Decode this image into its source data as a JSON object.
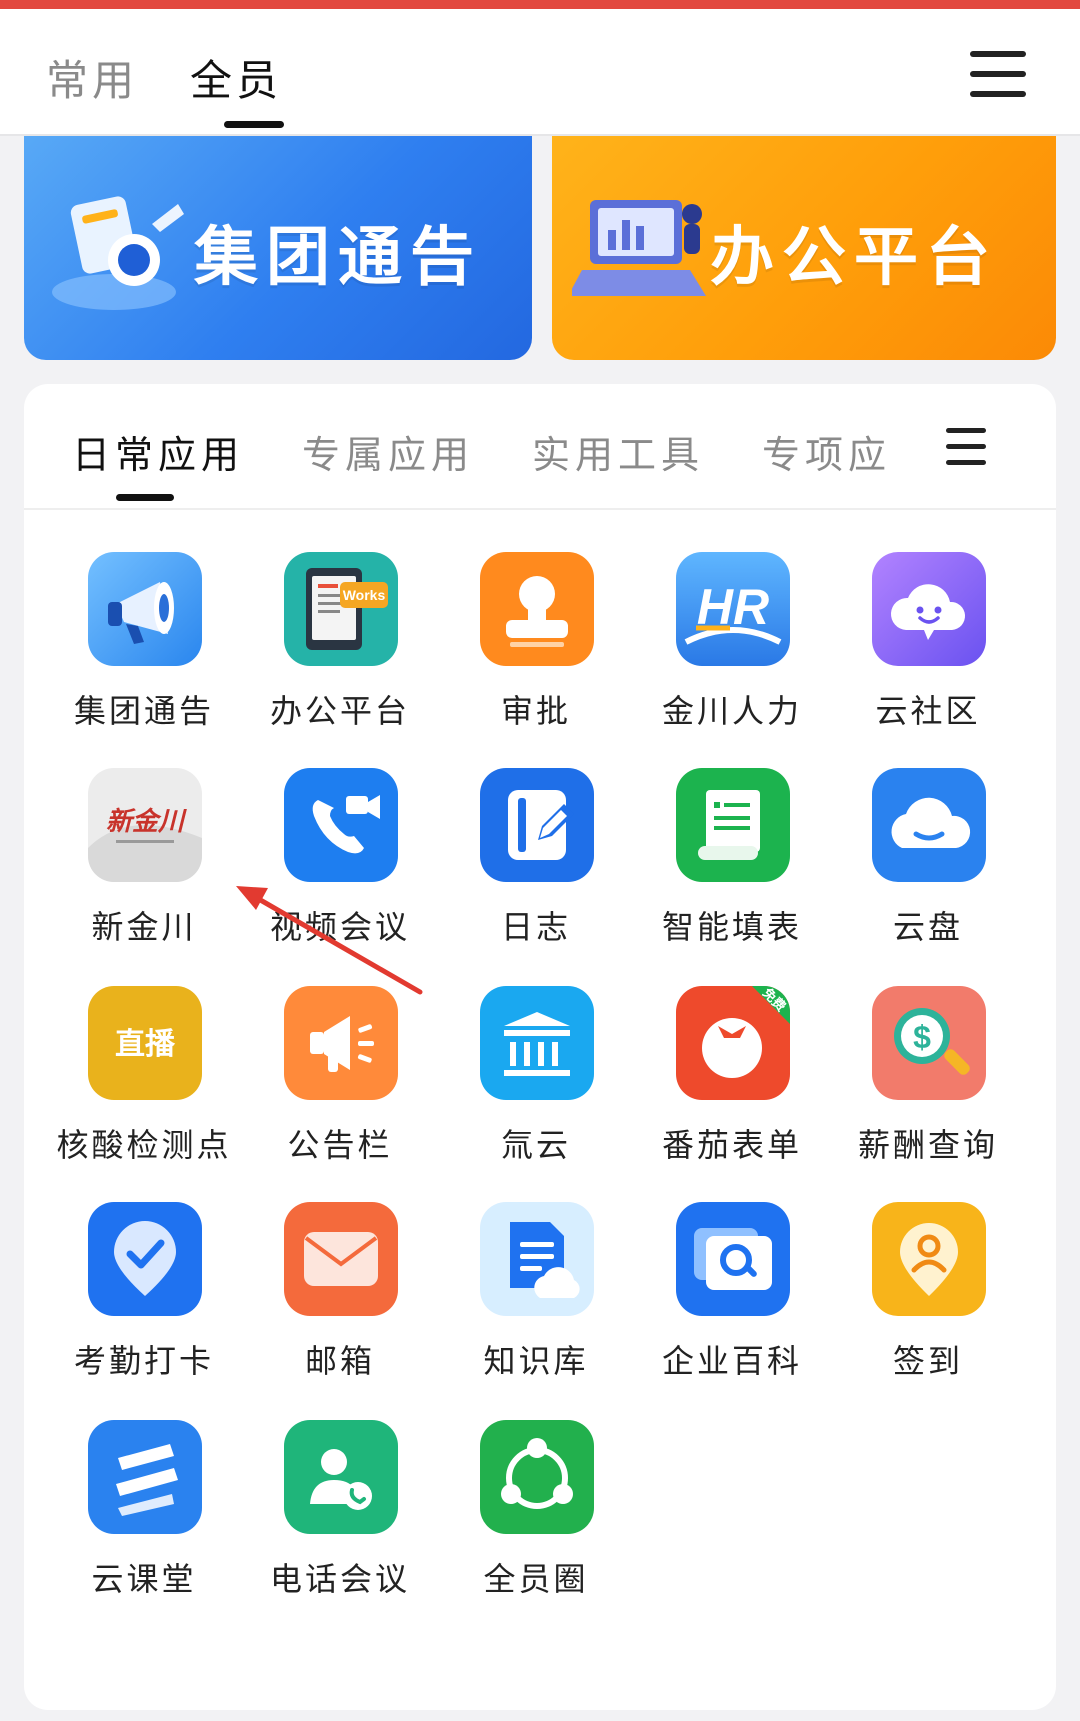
{
  "header": {
    "tabs": [
      {
        "label": "常用",
        "active": false
      },
      {
        "label": "全员",
        "active": true
      }
    ]
  },
  "banners": [
    {
      "title": "集团通告",
      "color": "#2f7ff0"
    },
    {
      "title": "办公平台",
      "color": "#ff9e0a"
    }
  ],
  "section_tabs": [
    {
      "label": "日常应用",
      "active": true
    },
    {
      "label": "专属应用",
      "active": false
    },
    {
      "label": "实用工具",
      "active": false
    },
    {
      "label": "专项应",
      "active": false
    }
  ],
  "apps": [
    {
      "label": "集团通告",
      "icon": "megaphone-icon"
    },
    {
      "label": "办公平台",
      "icon": "works-document-icon",
      "badge": "Works"
    },
    {
      "label": "审批",
      "icon": "stamp-icon"
    },
    {
      "label": "金川人力",
      "icon": "hr-logo-icon",
      "badge": "HR"
    },
    {
      "label": "云社区",
      "icon": "smile-cloud-icon"
    },
    {
      "label": "新金川",
      "icon": "xinjinchuan-logo-icon",
      "badge": "新金川"
    },
    {
      "label": "视频会议",
      "icon": "video-call-icon"
    },
    {
      "label": "日志",
      "icon": "notebook-pen-icon"
    },
    {
      "label": "智能填表",
      "icon": "scroll-form-icon"
    },
    {
      "label": "云盘",
      "icon": "cloud-drive-icon"
    },
    {
      "label": "核酸检测点",
      "icon": "live-broadcast-icon",
      "badge": "直播"
    },
    {
      "label": "公告栏",
      "icon": "announcement-horn-icon"
    },
    {
      "label": "氚云",
      "icon": "building-cloud-icon"
    },
    {
      "label": "番茄表单",
      "icon": "tomato-icon",
      "badge": "免费"
    },
    {
      "label": "薪酬查询",
      "icon": "salary-search-icon",
      "badge": "$"
    },
    {
      "label": "考勤打卡",
      "icon": "checkin-pin-icon"
    },
    {
      "label": "邮箱",
      "icon": "mail-icon"
    },
    {
      "label": "知识库",
      "icon": "knowledge-doc-icon"
    },
    {
      "label": "企业百科",
      "icon": "search-chat-icon"
    },
    {
      "label": "签到",
      "icon": "person-pin-icon"
    },
    {
      "label": "云课堂",
      "icon": "cloud-class-icon"
    },
    {
      "label": "电话会议",
      "icon": "phone-contact-icon"
    },
    {
      "label": "全员圈",
      "icon": "share-circle-icon"
    }
  ]
}
